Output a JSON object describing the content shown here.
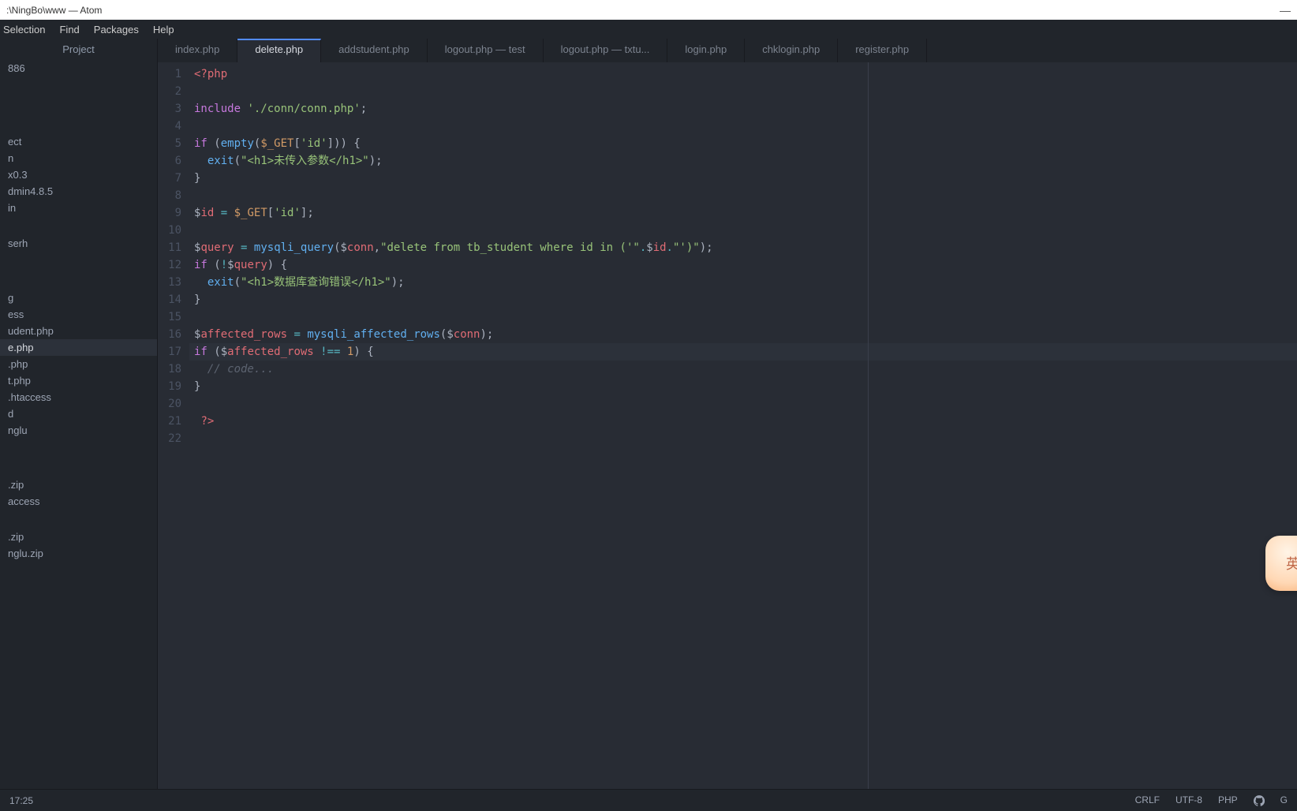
{
  "window": {
    "title": ":\\NingBo\\www — Atom"
  },
  "menu": [
    "Selection",
    "Find",
    "Packages",
    "Help"
  ],
  "sidebar": {
    "header": "Project",
    "items": [
      "886",
      "",
      "",
      "",
      "ect",
      "n",
      "x0.3",
      "dmin4.8.5",
      "in",
      "",
      "serh",
      "",
      "",
      "g",
      "ess",
      "udent.php",
      "e.php",
      ".php",
      "t.php",
      ".htaccess",
      "d",
      "nglu",
      "",
      "",
      ".zip",
      "access",
      "",
      ".zip",
      "nglu.zip"
    ],
    "selected_index": 16
  },
  "tabs": {
    "items": [
      "index.php",
      "delete.php",
      "addstudent.php",
      "logout.php — test",
      "logout.php — txtu...",
      "login.php",
      "chklogin.php",
      "register.php"
    ],
    "active_index": 1
  },
  "code": {
    "lines": [
      {
        "n": 1,
        "t": "<?php",
        "cls": "php-open"
      },
      {
        "n": 2,
        "t": ""
      },
      {
        "n": 3,
        "t": "include './conn/conn.php';",
        "cls": "include"
      },
      {
        "n": 4,
        "t": ""
      },
      {
        "n": 5,
        "t": "if (empty($_GET['id'])) {",
        "cls": "if-empty"
      },
      {
        "n": 6,
        "t": "  exit(\"<h1>未传入参数</h1>\");",
        "cls": "exit1"
      },
      {
        "n": 7,
        "t": "}"
      },
      {
        "n": 8,
        "t": ""
      },
      {
        "n": 9,
        "t": "$id = $_GET['id'];",
        "cls": "id-assign"
      },
      {
        "n": 10,
        "t": ""
      },
      {
        "n": 11,
        "t": "$query = mysqli_query($conn,\"delete from tb_student where id in ('\".$id.\"')\");",
        "cls": "query"
      },
      {
        "n": 12,
        "t": "if (!$query) {",
        "cls": "if-not-query"
      },
      {
        "n": 13,
        "t": "  exit(\"<h1>数据库查询错误</h1>\");",
        "cls": "exit2"
      },
      {
        "n": 14,
        "t": "}"
      },
      {
        "n": 15,
        "t": ""
      },
      {
        "n": 16,
        "t": "$affected_rows = mysqli_affected_rows($conn);",
        "cls": "affected"
      },
      {
        "n": 17,
        "t": "if ($affected_rows !== 1) {",
        "cls": "if-affected"
      },
      {
        "n": 18,
        "t": "  // code...",
        "cls": "comment"
      },
      {
        "n": 19,
        "t": "}"
      },
      {
        "n": 20,
        "t": ""
      },
      {
        "n": 21,
        "t": " ?>",
        "cls": "php-close"
      },
      {
        "n": 22,
        "t": ""
      }
    ]
  },
  "status": {
    "left": "17:25",
    "right": [
      "CRLF",
      "UTF-8",
      "PHP",
      "G"
    ]
  },
  "floaty": "英"
}
